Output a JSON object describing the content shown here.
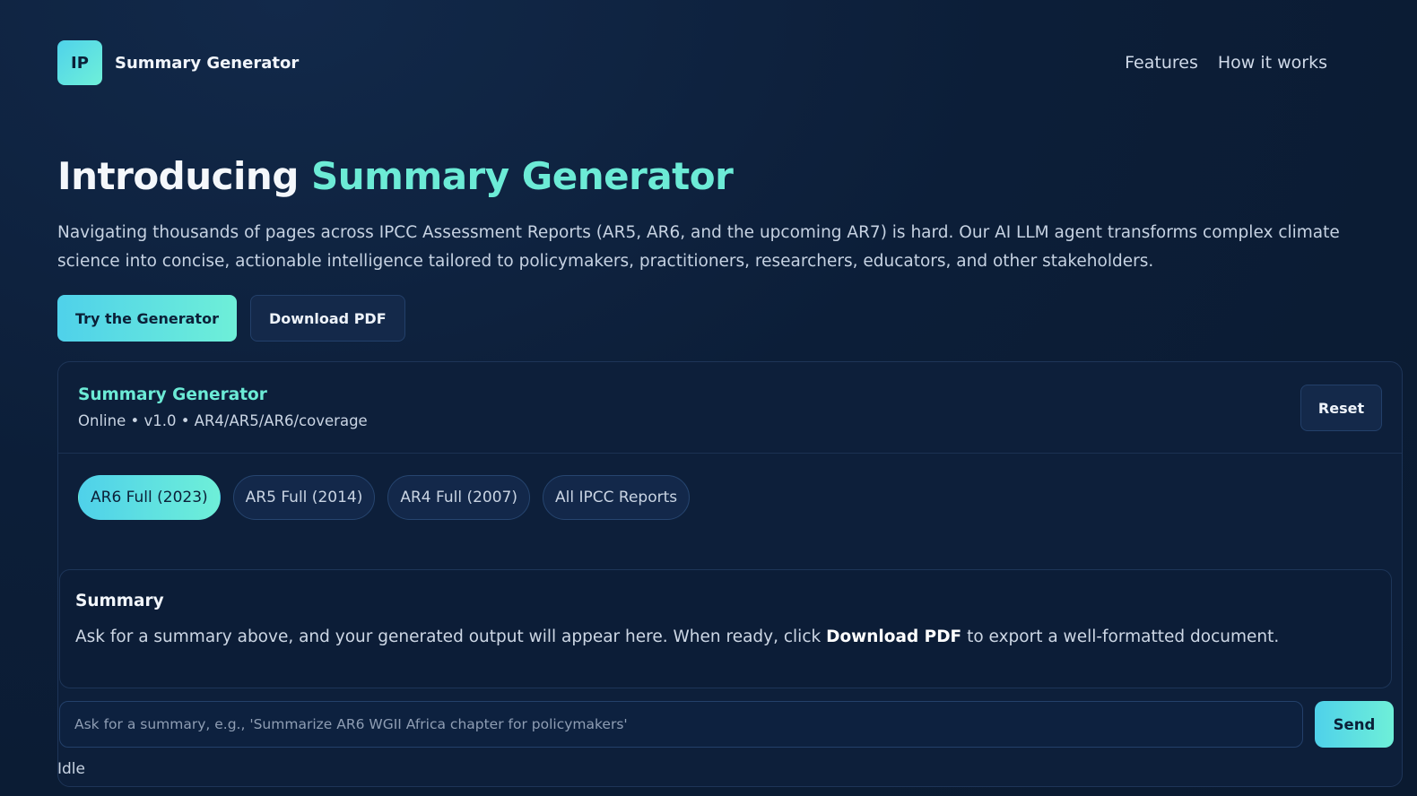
{
  "brand": {
    "badge": "IP",
    "name": "Summary Generator"
  },
  "nav": {
    "items": [
      {
        "label": "Features"
      },
      {
        "label": "How it works"
      }
    ]
  },
  "hero": {
    "title_prefix": "Introducing ",
    "title_accent": "Summary Generator",
    "description": "Navigating thousands of pages across IPCC Assessment Reports (AR5, AR6, and the upcoming AR7) is hard. Our AI LLM agent transforms complex climate science into concise, actionable intelligence tailored to policymakers, practitioners, researchers, educators, and other stakeholders.",
    "primary_cta": "Try the Generator",
    "secondary_cta": "Download PDF"
  },
  "panel": {
    "title": "Summary Generator",
    "subtitle": "Online • v1.0 • AR4/AR5/AR6/coverage",
    "reset_label": "Reset",
    "filters": [
      {
        "label": "AR6 Full (2023)",
        "active": true
      },
      {
        "label": "AR5 Full (2014)",
        "active": false
      },
      {
        "label": "AR4 Full (2007)",
        "active": false
      },
      {
        "label": "All IPCC Reports",
        "active": false
      }
    ],
    "summary": {
      "heading": "Summary",
      "text_before": "Ask for a summary above, and your generated output will appear here. When ready, click ",
      "text_bold": "Download PDF",
      "text_after": " to export a well-formatted document."
    },
    "prompt": {
      "value": "",
      "placeholder": "Ask for a summary, e.g., 'Summarize AR6 WGII Africa chapter for policymakers'"
    },
    "send_label": "Send",
    "status": "Idle"
  },
  "colors": {
    "accent": "#6cebd6",
    "accent_gradient_start": "#4fd1ea",
    "background": "#0c1e38",
    "panel": "#0d1f3a"
  }
}
